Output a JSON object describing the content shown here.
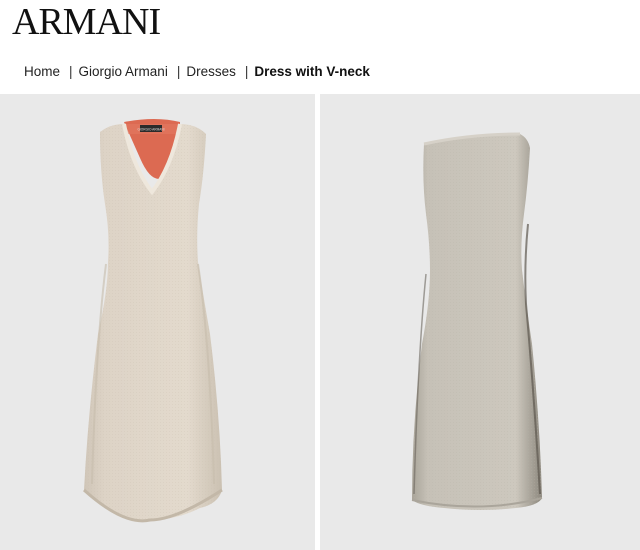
{
  "brand": {
    "logo_text": "ARMANI"
  },
  "breadcrumb": {
    "items": [
      {
        "label": "Home"
      },
      {
        "label": "Giorgio Armani"
      },
      {
        "label": "Dresses"
      }
    ],
    "separator": "|",
    "current": "Dress with V-neck"
  },
  "product_images": [
    {
      "view": "front",
      "label_text": "GIORGIO ARMANI",
      "dress_color": "#ddd3c6",
      "inner_color": "#dc6a52"
    },
    {
      "view": "back",
      "dress_color": "#c9c4ba"
    }
  ],
  "colors": {
    "gallery_background": "#e9e9e9",
    "text": "#111111"
  }
}
